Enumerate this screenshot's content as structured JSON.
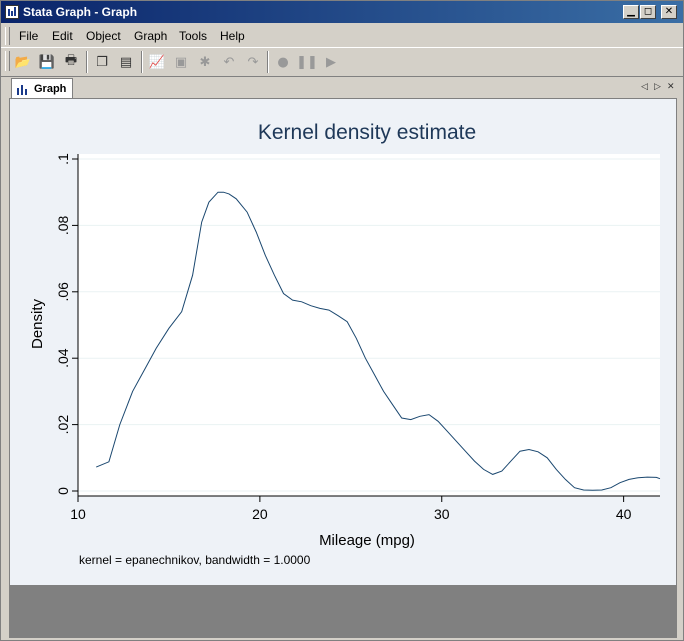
{
  "window": {
    "title": "Stata Graph - Graph",
    "controls": [
      "▁",
      "◻",
      "✕"
    ],
    "inner_controls": [
      "_",
      "□",
      "✕"
    ]
  },
  "menu": [
    {
      "label": "File"
    },
    {
      "label": "Edit"
    },
    {
      "label": "Object"
    },
    {
      "label": "Graph"
    },
    {
      "label": "Tools"
    },
    {
      "label": "Help"
    }
  ],
  "tabs": [
    {
      "label": "Graph"
    }
  ],
  "chart_data": {
    "type": "line",
    "title": "Kernel density estimate",
    "xlabel": "Mileage (mpg)",
    "ylabel": "Density",
    "note": "kernel = epanechnikov, bandwidth = 1.0000",
    "xlim": [
      10,
      42
    ],
    "ylim": [
      0,
      0.1
    ],
    "xticks": [
      10,
      20,
      30,
      40
    ],
    "yticks": [
      0,
      0.02,
      0.04,
      0.06,
      0.08,
      0.1
    ],
    "ytick_labels": [
      "0",
      ".02",
      ".04",
      ".06",
      ".08",
      ".1"
    ],
    "grid": true,
    "color": "#1a476f",
    "series": [
      {
        "x": [
          11,
          11.7,
          12.3,
          13,
          13.7,
          14.3,
          15,
          15.7,
          16.3,
          16.8,
          17.2,
          17.7,
          18,
          18.3,
          18.7,
          19.3,
          19.8,
          20.3,
          20.8,
          21.3,
          21.8,
          22.3,
          22.8,
          23.3,
          23.8,
          24.3,
          24.8,
          25.3,
          25.8,
          26.3,
          26.8,
          27.3,
          27.8,
          28.3,
          28.8,
          29.3,
          29.8,
          30.3,
          30.8,
          31.3,
          31.8,
          32.3,
          32.8,
          33.3,
          33.8,
          34.3,
          34.8,
          35.3,
          35.8,
          36.3,
          36.8,
          37.3,
          37.8,
          38.3,
          38.8,
          39.3,
          39.8,
          40.3,
          40.8,
          41.3,
          41.8,
          42
        ],
        "y": [
          0.0072,
          0.0088,
          0.02,
          0.03,
          0.037,
          0.043,
          0.049,
          0.054,
          0.065,
          0.081,
          0.087,
          0.09,
          0.09,
          0.0895,
          0.088,
          0.084,
          0.078,
          0.071,
          0.065,
          0.0595,
          0.0575,
          0.057,
          0.0558,
          0.055,
          0.0545,
          0.0528,
          0.051,
          0.046,
          0.04,
          0.035,
          0.03,
          0.026,
          0.022,
          0.0215,
          0.0225,
          0.023,
          0.021,
          0.018,
          0.015,
          0.012,
          0.009,
          0.0065,
          0.005,
          0.006,
          0.009,
          0.012,
          0.0125,
          0.0118,
          0.01,
          0.0065,
          0.0035,
          0.001,
          0.0003,
          0.0002,
          0.0003,
          0.001,
          0.0025,
          0.0035,
          0.004,
          0.0042,
          0.0041,
          0.0037
        ]
      }
    ]
  }
}
